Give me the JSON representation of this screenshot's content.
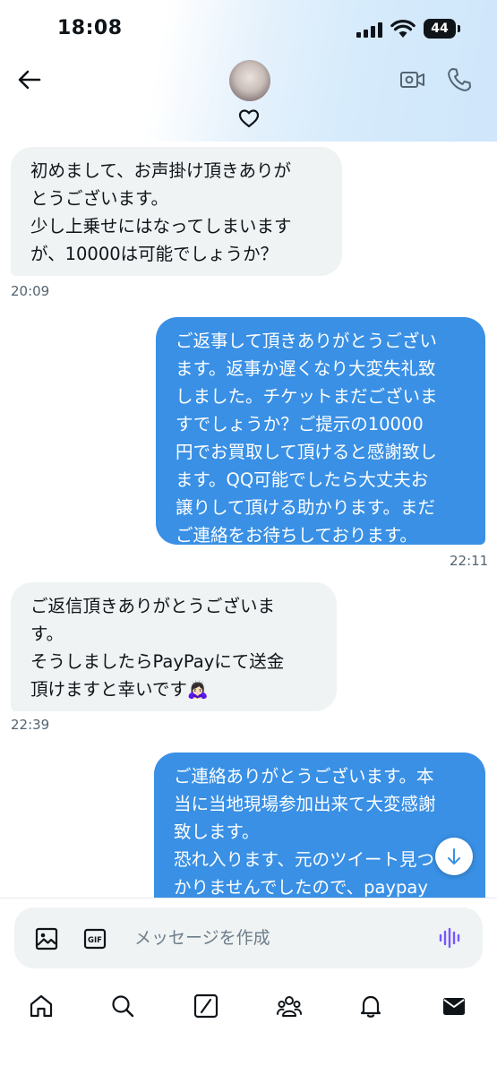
{
  "status_bar": {
    "time": "18:08",
    "battery": "44"
  },
  "header": {
    "has_heart": true
  },
  "messages": [
    {
      "direction": "incoming",
      "text": "初めまして、お声掛け頂きありが\nとうございます。\n少し上乗せにはなってしまいます\nが、10000は可能でしょうか？",
      "time": "20:09"
    },
    {
      "direction": "outgoing",
      "text": "ご返事して頂きありがとうござい\nます。返事か遅くなり大変失礼致\nしました。チケットまだございま\nすでしょうか？ご提示の10000\n円でお買取して頂けると感謝致し\nます。QQ可能でしたら大丈夫お\n譲りして頂ける助かります。まだ\nご連絡をお待ちしております。",
      "time": "22:11"
    },
    {
      "direction": "incoming",
      "text": "ご返信頂きありがとうございま\nす。\nそうしましたらPayPayにて送金\n頂けますと幸いです🙇🏻‍♀️",
      "time": "22:39"
    },
    {
      "direction": "outgoing",
      "text": "ご連絡ありがとうございます。本\n当に当地現場参加出来て大変感謝\n致します。\n恐れ入ります、元のツイート見つ\nかりませんでしたので、paypay\n送金前に再度取引の詳細を確認さ",
      "time": ""
    }
  ],
  "composer": {
    "placeholder": "メッセージを作成"
  },
  "colors": {
    "outgoing_bubble": "#3990e5",
    "incoming_bubble": "#eff3f4",
    "voice_icon": "#7856ff"
  },
  "tabs": [
    "home-icon",
    "search-icon",
    "grok-icon",
    "communities-icon",
    "notifications-icon",
    "messages-icon"
  ]
}
